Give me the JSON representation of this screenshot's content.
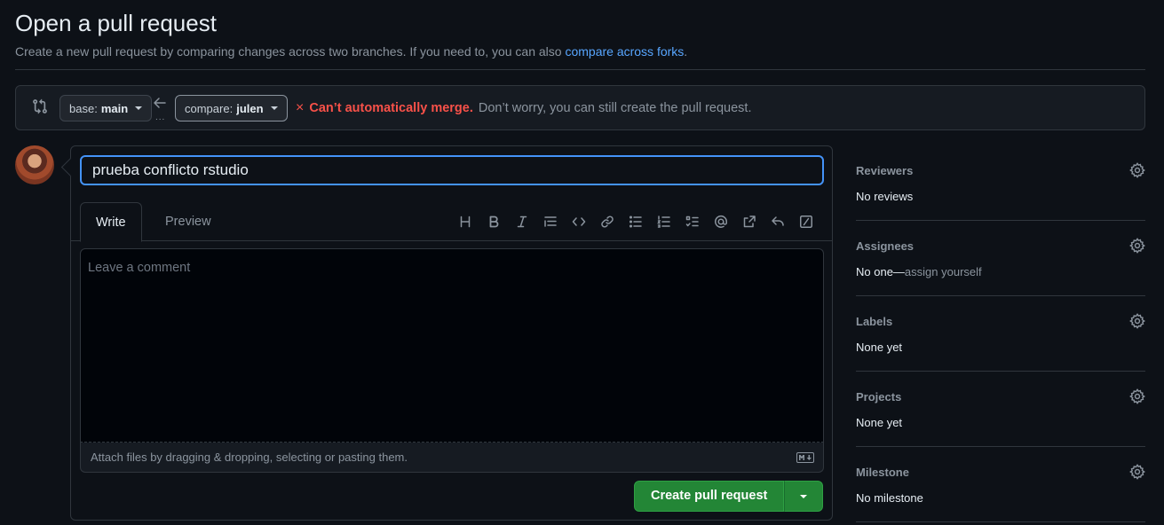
{
  "header": {
    "title": "Open a pull request",
    "subtitle_text": "Create a new pull request by comparing changes across two branches. If you need to, you can also ",
    "subtitle_link": "compare across forks",
    "subtitle_end": "."
  },
  "compare": {
    "base_prefix": "base:",
    "base_branch": "main",
    "compare_prefix": "compare:",
    "compare_branch": "julen",
    "dots": "...",
    "status_icon": "×",
    "status_strong": "Can’t automatically merge.",
    "status_rest": "Don’t worry, you can still create the pull request."
  },
  "editor": {
    "title_value": "prueba conflicto rstudio",
    "tab_write": "Write",
    "tab_preview": "Preview",
    "comment_placeholder": "Leave a comment",
    "attach_text": "Attach files by dragging & dropping, selecting or pasting them.",
    "create_button": "Create pull request",
    "toolbar_icons": [
      "heading-icon",
      "bold-icon",
      "italic-icon",
      "quote-icon",
      "code-icon",
      "link-icon",
      "bulleted-list-icon",
      "numbered-list-icon",
      "task-list-icon",
      "mention-icon",
      "cross-reference-icon",
      "reply-icon",
      "slash-command-icon"
    ]
  },
  "sidebar": {
    "reviewers": {
      "heading": "Reviewers",
      "value": "No reviews"
    },
    "assignees": {
      "heading": "Assignees",
      "value": "No one—",
      "link": "assign yourself"
    },
    "labels": {
      "heading": "Labels",
      "value": "None yet"
    },
    "projects": {
      "heading": "Projects",
      "value": "None yet"
    },
    "milestone": {
      "heading": "Milestone",
      "value": "No milestone"
    }
  },
  "colors": {
    "background": "#0d1117",
    "accent_link": "#58a6ff",
    "danger": "#f85149",
    "primary_button": "#238636"
  }
}
